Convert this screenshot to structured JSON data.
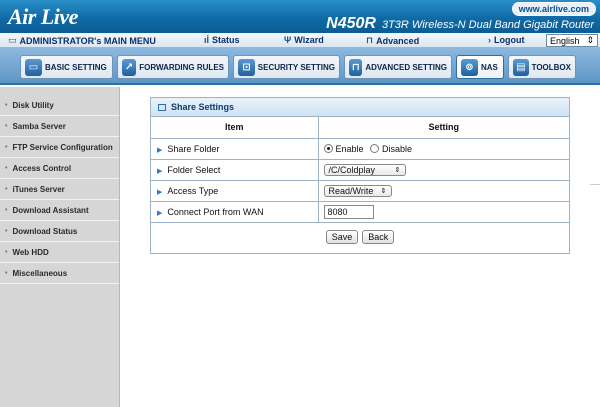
{
  "header": {
    "logo": "Air Live",
    "url_badge": "www.airlive.com",
    "model": "N450R",
    "product_desc": "3T3R Wireless-N Dual Band Gigabit Router"
  },
  "menubar": {
    "main_menu": "ADMINISTRATOR's MAIN MENU",
    "status": "Status",
    "wizard": "Wizard",
    "advanced": "Advanced",
    "logout": "Logout",
    "language": "English"
  },
  "tabs": [
    {
      "label": "BASIC SETTING",
      "icon": "monitor-icon"
    },
    {
      "label": "FORWARDING RULES",
      "icon": "forward-icon"
    },
    {
      "label": "SECURITY SETTING",
      "icon": "lock-icon"
    },
    {
      "label": "ADVANCED SETTING",
      "icon": "tools-icon"
    },
    {
      "label": "NAS",
      "icon": "nas-icon"
    },
    {
      "label": "TOOLBOX",
      "icon": "toolbox-icon"
    }
  ],
  "sidebar": {
    "items": [
      {
        "label": "Disk Utility"
      },
      {
        "label": "Samba Server"
      },
      {
        "label": "FTP Service Configuration"
      },
      {
        "label": "Access Control"
      },
      {
        "label": "iTunes Server"
      },
      {
        "label": "Download Assistant"
      },
      {
        "label": "Download Status"
      },
      {
        "label": "Web HDD"
      },
      {
        "label": "Miscellaneous"
      }
    ]
  },
  "panel": {
    "title": "Share Settings",
    "col_item": "Item",
    "col_setting": "Setting",
    "rows": {
      "share_folder": {
        "label": "Share Folder",
        "enable": "Enable",
        "disable": "Disable",
        "selected": "Enable"
      },
      "folder_select": {
        "label": "Folder Select",
        "value": "/C/Coldplay"
      },
      "access_type": {
        "label": "Access Type",
        "value": "Read/Write"
      },
      "connect_port": {
        "label": "Connect Port from WAN",
        "value": "8080"
      }
    },
    "save": "Save",
    "back": "Back"
  },
  "colors": {
    "banner": "#0f6aa6",
    "sidebar_bg": "#d6d6d6",
    "panel_border": "#9fb3c8"
  }
}
